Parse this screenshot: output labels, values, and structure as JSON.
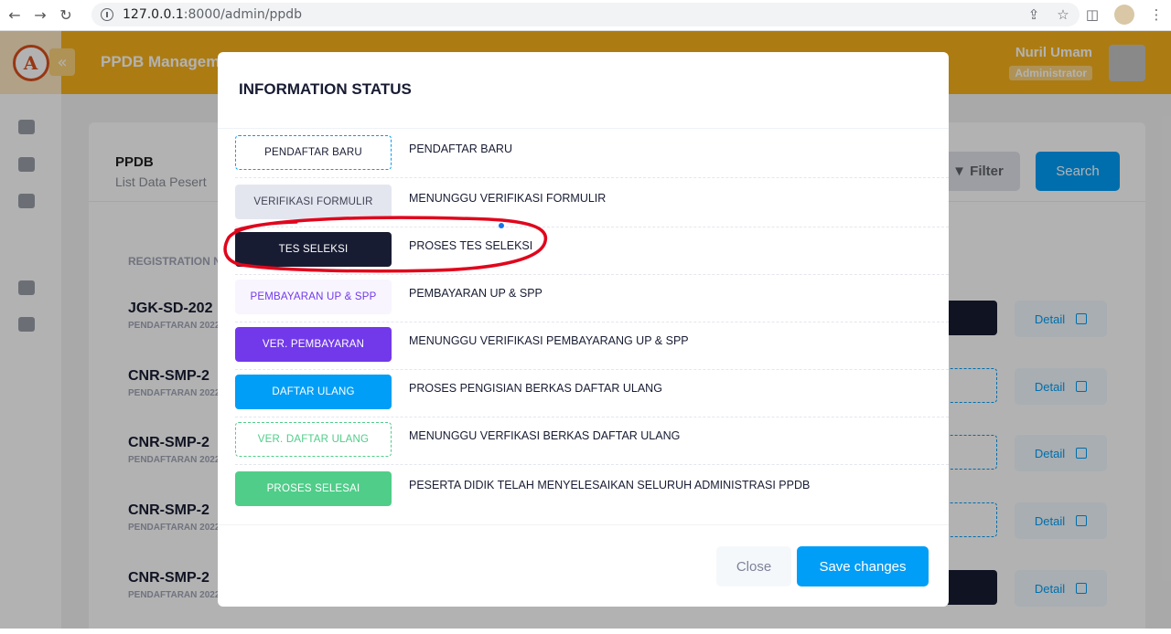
{
  "browser": {
    "url_host": "127.0.0.1",
    "url_rest": ":8000/admin/ppdb"
  },
  "app": {
    "title": "PPDB Managem",
    "user_name": "Nuril Umam",
    "user_role": "Administrator",
    "card_title": "PPDB",
    "card_subtitle": "List Data Pesert",
    "filter_label": "Filter",
    "search_label": "Search",
    "table_header": "REGISTRATION N",
    "rows": [
      {
        "reg": "JGK-SD-202",
        "sub": "PENDAFTARAN 2022",
        "detail": "Detail"
      },
      {
        "reg": "CNR-SMP-2",
        "sub": "PENDAFTARAN 2022",
        "detail": "Detail"
      },
      {
        "reg": "CNR-SMP-2",
        "sub": "PENDAFTARAN 2022",
        "detail": "Detail"
      },
      {
        "reg": "CNR-SMP-2",
        "sub": "PENDAFTARAN 2022",
        "detail": "Detail"
      },
      {
        "reg": "CNR-SMP-2",
        "sub": "PENDAFTARAN 2022",
        "detail": "Detail"
      }
    ]
  },
  "modal": {
    "title": "INFORMATION STATUS",
    "statuses": [
      {
        "badge": "PENDAFTAR BARU",
        "desc": "PENDAFTAR BARU"
      },
      {
        "badge": "VERIFIKASI FORMULIR",
        "desc": "MENUNGGU VERIFIKASI FORMULIR"
      },
      {
        "badge": "TES SELEKSI",
        "desc": "PROSES TES SELEKSI"
      },
      {
        "badge": "PEMBAYARAN UP & SPP",
        "desc": "PEMBAYARAN UP & SPP"
      },
      {
        "badge": "VER. PEMBAYARAN",
        "desc": "MENUNGGU VERIFIKASI PEMBAYARANG UP & SPP"
      },
      {
        "badge": "DAFTAR ULANG",
        "desc": "PROSES PENGISIAN BERKAS DAFTAR ULANG"
      },
      {
        "badge": "VER. DAFTAR ULANG",
        "desc": "MENUNGGU VERFIKASI BERKAS DAFTAR ULANG"
      },
      {
        "badge": "PROSES SELESAI",
        "desc": "PESERTA DIDIK TELAH MENYELESAIKAN SELURUH ADMINISTRASI PPDB"
      }
    ],
    "close_label": "Close",
    "save_label": "Save changes"
  },
  "colors": {
    "primary": "#009ef7",
    "warning": "#f7b21c",
    "dark": "#181c32",
    "purple": "#7239ea",
    "success": "#50cd89",
    "annotation": "#e0061c"
  }
}
